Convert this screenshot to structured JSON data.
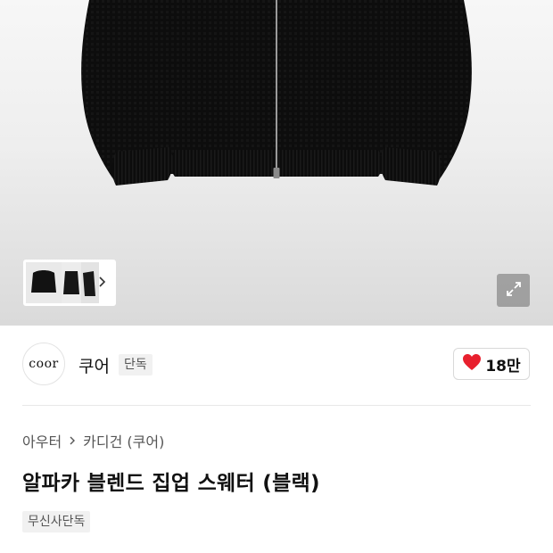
{
  "gallery": {
    "image_description_icon": "black-alpaca-zip-up-sweater-image",
    "thumbnail_count_visible": 3,
    "next_icon": "chevron-right-icon",
    "expand_icon": "expand-icon"
  },
  "brand": {
    "logo_text": "coor",
    "name": "쿠어",
    "badge": "단독"
  },
  "like": {
    "icon": "heart-icon",
    "count": "18만",
    "color": "#e8202e"
  },
  "breadcrumb": {
    "items": [
      "아우터",
      "카디건 (쿠어)"
    ]
  },
  "product": {
    "title": "알파카 블렌드 집업 스웨터 (블랙)",
    "tag": "무신사단독"
  }
}
